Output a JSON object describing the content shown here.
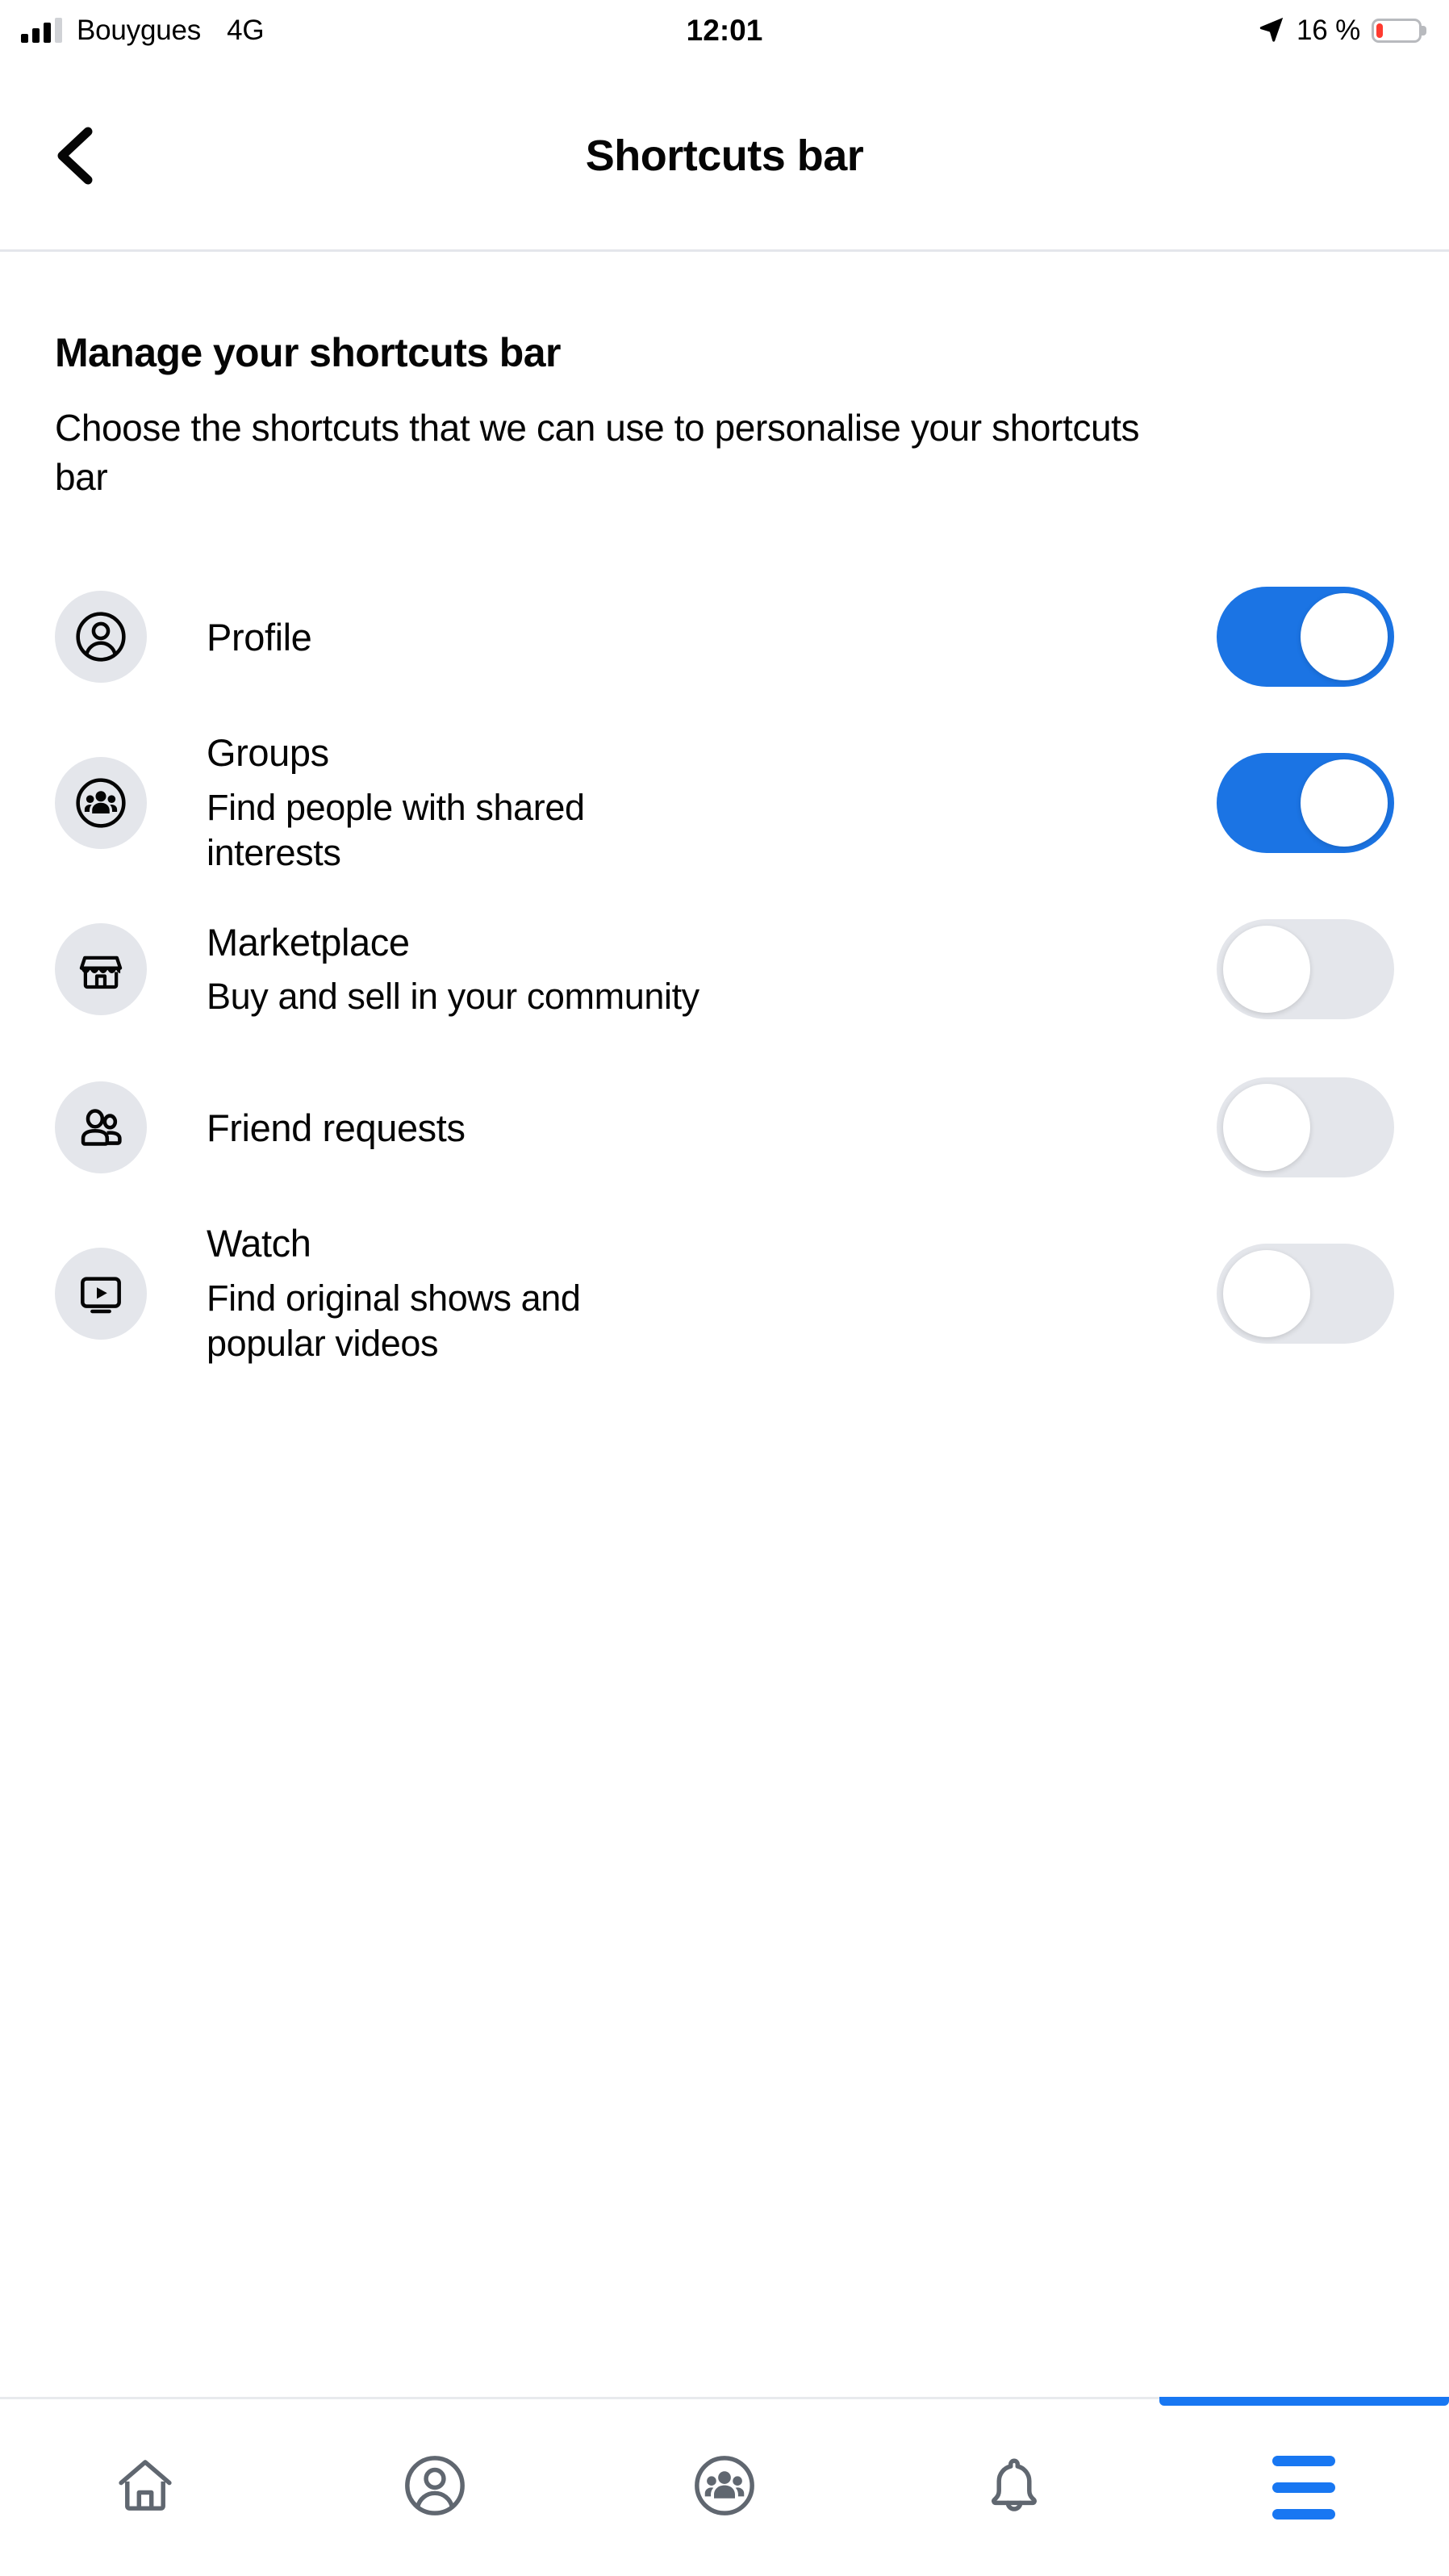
{
  "status_bar": {
    "carrier": "Bouygues",
    "network": "4G",
    "clock": "12:01",
    "battery_percent": "16 %",
    "battery_level": 16,
    "battery_color": "#FF3B30",
    "signal_icon": "signal-bars-icon",
    "location_icon": "location-arrow-icon",
    "battery_icon": "battery-icon"
  },
  "header": {
    "title": "Shortcuts bar",
    "back_icon": "chevron-left-icon"
  },
  "main": {
    "section_title": "Manage your shortcuts bar",
    "section_description": "Choose the shortcuts that we can use to personalise your shortcuts bar",
    "shortcuts": [
      {
        "title": "Profile",
        "subtitle": "",
        "icon": "person-circle-icon",
        "enabled": true,
        "toggle_state": "on"
      },
      {
        "title": "Groups",
        "subtitle": "Find people with shared interests",
        "icon": "groups-circle-icon",
        "enabled": true,
        "toggle_state": "on"
      },
      {
        "title": "Marketplace",
        "subtitle": "Buy and sell in your community",
        "icon": "storefront-icon",
        "enabled": false,
        "toggle_state": "off"
      },
      {
        "title": "Friend requests",
        "subtitle": "",
        "icon": "two-people-icon",
        "enabled": false,
        "toggle_state": "off"
      },
      {
        "title": "Watch",
        "subtitle": "Find original shows and popular videos",
        "icon": "video-screen-play-icon",
        "enabled": false,
        "toggle_state": "off"
      }
    ]
  },
  "tabbar": {
    "tabs": [
      {
        "name": "home",
        "icon": "home-icon",
        "active": false
      },
      {
        "name": "profile",
        "icon": "person-circle-icon",
        "active": false
      },
      {
        "name": "groups",
        "icon": "groups-circle-icon",
        "active": false
      },
      {
        "name": "notifications",
        "icon": "bell-icon",
        "active": false
      },
      {
        "name": "menu",
        "icon": "hamburger-menu-icon",
        "active": true
      }
    ]
  },
  "colors": {
    "toggle_on": "#1B74E4",
    "toggle_off": "#E4E6EB",
    "accent_blue": "#1877F2",
    "icon_bg": "#E4E6EB",
    "text_primary": "#050505",
    "tab_icon": "#606770",
    "divider": "#E4E6EB"
  }
}
